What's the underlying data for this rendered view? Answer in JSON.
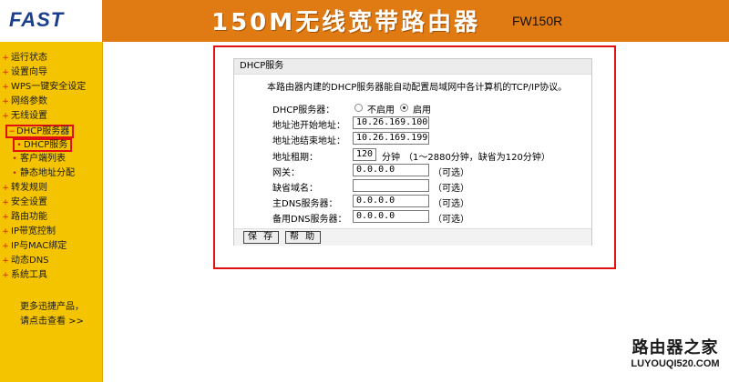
{
  "header": {
    "logo": "FAST",
    "product_title": "150M无线宽带路由器",
    "model": "FW150R"
  },
  "sidebar": {
    "items": [
      {
        "label": "运行状态",
        "mark": "+"
      },
      {
        "label": "设置向导",
        "mark": "+"
      },
      {
        "label": "WPS一键安全设定",
        "mark": "+"
      },
      {
        "label": "网络参数",
        "mark": "+"
      },
      {
        "label": "无线设置",
        "mark": "+"
      },
      {
        "label": "DHCP服务器",
        "mark": "−"
      },
      {
        "label": "DHCP服务",
        "mark": "•"
      },
      {
        "label": "客户端列表",
        "mark": "•"
      },
      {
        "label": "静态地址分配",
        "mark": "•"
      },
      {
        "label": "转发规则",
        "mark": "+"
      },
      {
        "label": "安全设置",
        "mark": "+"
      },
      {
        "label": "路由功能",
        "mark": "+"
      },
      {
        "label": "IP带宽控制",
        "mark": "+"
      },
      {
        "label": "IP与MAC绑定",
        "mark": "+"
      },
      {
        "label": "动态DNS",
        "mark": "+"
      },
      {
        "label": "系统工具",
        "mark": "+"
      }
    ],
    "more_line1": "更多迅捷产品，",
    "more_line2": "请点击查看 >>"
  },
  "panel": {
    "title": "DHCP服务",
    "description": "本路由器内建的DHCP服务器能自动配置局域网中各计算机的TCP/IP协议。",
    "dhcp_label": "DHCP服务器：",
    "disable_label": "不启用",
    "enable_label": "启用",
    "dhcp_enabled": true,
    "start_label": "地址池开始地址：",
    "start_value": "10.26.169.100",
    "end_label": "地址池结束地址：",
    "end_value": "10.26.169.199",
    "lease_label": "地址租期：",
    "lease_value": "120",
    "lease_unit": "分钟",
    "lease_hint": "（1～2880分钟，缺省为120分钟）",
    "gateway_label": "网关：",
    "gateway_value": "0.0.0.0",
    "domain_label": "缺省域名：",
    "domain_value": "",
    "dns1_label": "主DNS服务器：",
    "dns1_value": "0.0.0.0",
    "dns2_label": "备用DNS服务器：",
    "dns2_value": "0.0.0.0",
    "optional": "（可选）",
    "save_label": "保 存",
    "help_label": "帮 助"
  },
  "watermark": {
    "line1": "路由器之家",
    "line2": "LUYOUQI520.COM"
  }
}
